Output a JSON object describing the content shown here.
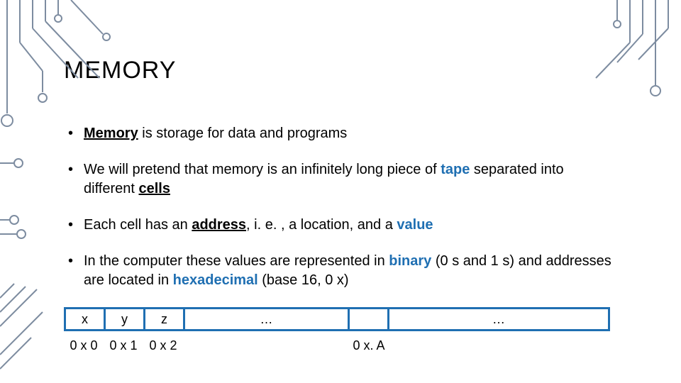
{
  "title": "MEMORY",
  "bullets": {
    "b1": {
      "kw": "Memory",
      "rest": " is storage for data and programs"
    },
    "b2": {
      "pre": "We will pretend that memory is an infinitely long piece of ",
      "kw1": "tape",
      "mid": " separated into different ",
      "kw2": "cells"
    },
    "b3": {
      "pre": "Each cell has an ",
      "kw1": "address",
      "mid": ", i. e. , a location, and a ",
      "kw2": "value"
    },
    "b4": {
      "pre": "In the computer these values are represented in ",
      "kw1": "binary",
      "mid1": " (0 s and 1 s) and addresses are located in ",
      "kw2": "hexadecimal",
      "mid2": " (base 16, 0 x)"
    }
  },
  "tape": {
    "cells": {
      "c0": "x",
      "c1": "y",
      "c2": "z",
      "c3": "…",
      "c4": "",
      "c5": "…"
    },
    "addresses": {
      "a0": "0 x 0",
      "a1": "0 x 1",
      "a2": "0 x 2",
      "a3": "0 x. A"
    }
  },
  "colors": {
    "accent": "#1f6fb2",
    "line": "#7d8ca0"
  }
}
